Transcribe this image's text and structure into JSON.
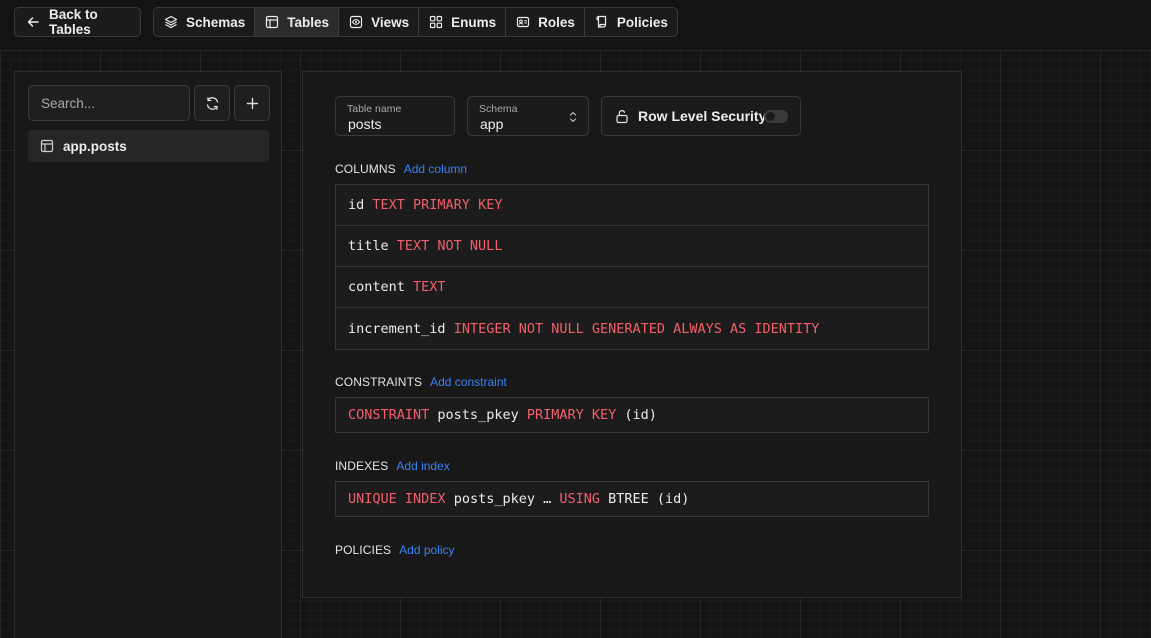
{
  "topbar": {
    "back_label": "Back to Tables",
    "tabs": [
      {
        "label": "Schemas",
        "icon": "layers-icon"
      },
      {
        "label": "Tables",
        "icon": "table-icon",
        "active": true
      },
      {
        "label": "Views",
        "icon": "eye-icon"
      },
      {
        "label": "Enums",
        "icon": "grid-icon"
      },
      {
        "label": "Roles",
        "icon": "id-card-icon"
      },
      {
        "label": "Policies",
        "icon": "scroll-icon"
      }
    ]
  },
  "sidebar": {
    "search_placeholder": "Search...",
    "tables": [
      "app.posts"
    ]
  },
  "form": {
    "table_name_label": "Table name",
    "table_name_value": "posts",
    "schema_label": "Schema",
    "schema_value": "app",
    "rls_label": "Row Level Security"
  },
  "columns": {
    "title": "COLUMNS",
    "add_label": "Add column",
    "rows": [
      {
        "name": "id",
        "def": "TEXT PRIMARY KEY"
      },
      {
        "name": "title",
        "def": "TEXT NOT NULL"
      },
      {
        "name": "content",
        "def": "TEXT"
      },
      {
        "name": "increment_id",
        "def": "INTEGER NOT NULL GENERATED ALWAYS AS IDENTITY"
      }
    ]
  },
  "constraints": {
    "title": "CONSTRAINTS",
    "add_label": "Add constraint",
    "rows": [
      {
        "kw1": "CONSTRAINT",
        "name": "posts_pkey",
        "kw2": "PRIMARY KEY",
        "cols": "(id)"
      }
    ]
  },
  "indexes": {
    "title": "INDEXES",
    "add_label": "Add index",
    "rows": [
      {
        "kw1": "UNIQUE INDEX",
        "name": "posts_pkey …",
        "kw2": "USING",
        "method": "BTREE (id)"
      }
    ]
  },
  "policies": {
    "title": "POLICIES",
    "add_label": "Add policy"
  },
  "colors": {
    "keyword": "#f25f6a",
    "link": "#3b82f6",
    "background": "#141414",
    "panel": "#181818"
  }
}
